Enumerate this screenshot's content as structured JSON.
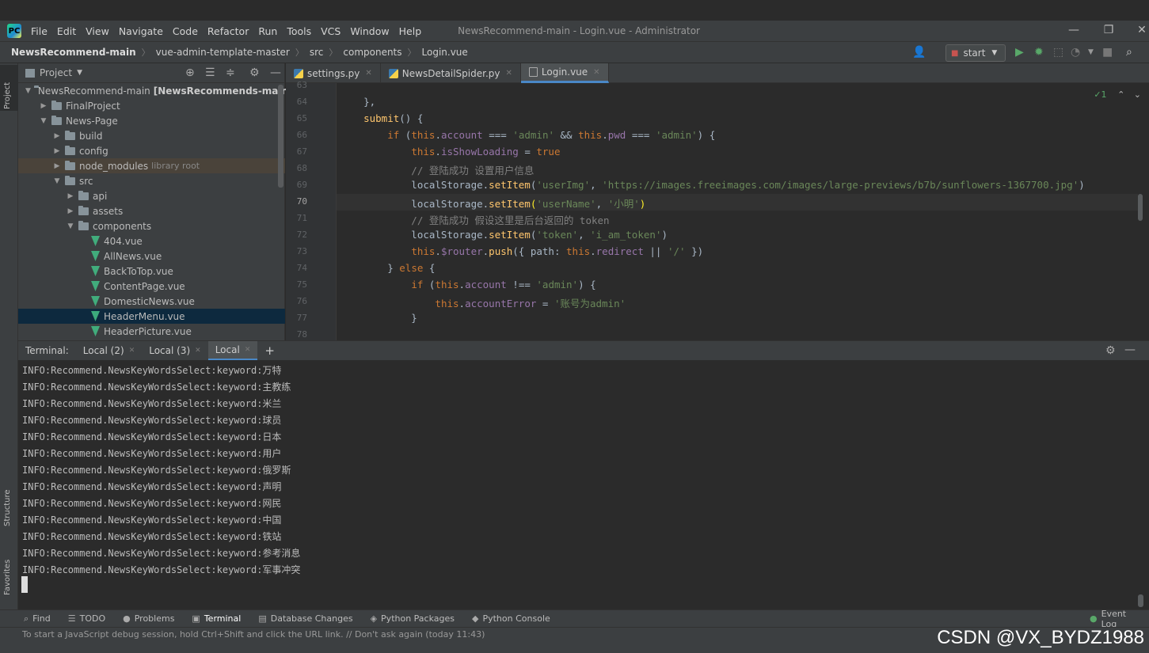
{
  "menubar": {
    "items": [
      "File",
      "Edit",
      "View",
      "Navigate",
      "Code",
      "Refactor",
      "Run",
      "Tools",
      "VCS",
      "Window",
      "Help"
    ],
    "window_title": "NewsRecommend-main - Login.vue - Administrator"
  },
  "navbar": {
    "crumbs": [
      "NewsRecommend-main",
      "vue-admin-template-master",
      "src",
      "components",
      "Login.vue"
    ],
    "run_config": "start"
  },
  "left_strip": {
    "project": "Project",
    "structure": "Structure",
    "favorites": "Favorites"
  },
  "project_panel": {
    "title": "Project",
    "tree": [
      {
        "label": "NewsRecommend-main",
        "extra": "[NewsRecommends-main]",
        "type": "folder",
        "open": true,
        "depth": 0
      },
      {
        "label": "FinalProject",
        "type": "folder",
        "open": false,
        "depth": 1
      },
      {
        "label": "News-Page",
        "type": "folder",
        "open": true,
        "depth": 1
      },
      {
        "label": "build",
        "type": "folder",
        "open": false,
        "depth": 2
      },
      {
        "label": "config",
        "type": "folder",
        "open": false,
        "depth": 2
      },
      {
        "label": "node_modules",
        "extra": "library root",
        "type": "folder",
        "open": false,
        "depth": 2,
        "lib": true
      },
      {
        "label": "src",
        "type": "folder",
        "open": true,
        "depth": 2
      },
      {
        "label": "api",
        "type": "folder",
        "open": false,
        "depth": 3
      },
      {
        "label": "assets",
        "type": "folder",
        "open": false,
        "depth": 3
      },
      {
        "label": "components",
        "type": "folder",
        "open": true,
        "depth": 3
      },
      {
        "label": "404.vue",
        "type": "vue",
        "depth": 4
      },
      {
        "label": "AllNews.vue",
        "type": "vue",
        "depth": 4
      },
      {
        "label": "BackToTop.vue",
        "type": "vue",
        "depth": 4
      },
      {
        "label": "ContentPage.vue",
        "type": "vue",
        "depth": 4
      },
      {
        "label": "DomesticNews.vue",
        "type": "vue",
        "depth": 4
      },
      {
        "label": "HeaderMenu.vue",
        "type": "vue",
        "depth": 4,
        "selected": true
      },
      {
        "label": "HeaderPicture.vue",
        "type": "vue",
        "depth": 4
      }
    ]
  },
  "editor": {
    "tabs": [
      {
        "label": "settings.py",
        "kind": "py",
        "active": false
      },
      {
        "label": "NewsDetailSpider.py",
        "kind": "py",
        "active": false
      },
      {
        "label": "Login.vue",
        "kind": "vue",
        "active": true
      }
    ],
    "inspection": "✓1",
    "current_line": "70",
    "lines": [
      {
        "n": "63",
        "tokens": [
          [
            "",
            ""
          ]
        ]
      },
      {
        "n": "64",
        "tokens": [
          [
            "    },",
            "p"
          ]
        ]
      },
      {
        "n": "65",
        "tokens": [
          [
            "    ",
            "p"
          ],
          [
            "submit",
            "fn"
          ],
          [
            "() {",
            "p"
          ]
        ]
      },
      {
        "n": "66",
        "tokens": [
          [
            "        ",
            "p"
          ],
          [
            "if",
            "kw"
          ],
          [
            " (",
            "p"
          ],
          [
            "this",
            "kw"
          ],
          [
            ".",
            "p"
          ],
          [
            "account",
            "fld"
          ],
          [
            " === ",
            "p"
          ],
          [
            "'admin'",
            "str"
          ],
          [
            " && ",
            "p"
          ],
          [
            "this",
            "kw"
          ],
          [
            ".",
            "p"
          ],
          [
            "pwd",
            "fld"
          ],
          [
            " === ",
            "p"
          ],
          [
            "'admin'",
            "str"
          ],
          [
            ") {",
            "p"
          ]
        ]
      },
      {
        "n": "67",
        "tokens": [
          [
            "            ",
            "p"
          ],
          [
            "this",
            "kw"
          ],
          [
            ".",
            "p"
          ],
          [
            "isShowLoading",
            "fld"
          ],
          [
            " = ",
            "p"
          ],
          [
            "true",
            "kw"
          ]
        ]
      },
      {
        "n": "68",
        "tokens": [
          [
            "            // 登陆成功 设置用户信息",
            "cmt"
          ]
        ]
      },
      {
        "n": "69",
        "tokens": [
          [
            "            localStorage.",
            "p"
          ],
          [
            "setItem",
            "fn"
          ],
          [
            "(",
            "p"
          ],
          [
            "'userImg'",
            "str"
          ],
          [
            ", ",
            "p"
          ],
          [
            "'https://images.freeimages.com/images/large-previews/b7b/sunflowers-1367700.jpg'",
            "str"
          ],
          [
            ")",
            "p"
          ]
        ]
      },
      {
        "n": "70",
        "tokens": [
          [
            "            localStorage.",
            "p"
          ],
          [
            "setItem",
            "fn"
          ],
          [
            "(",
            "hl"
          ],
          [
            "'userName'",
            "str"
          ],
          [
            ", ",
            "p"
          ],
          [
            "'小明'",
            "str"
          ],
          [
            ")",
            "hl"
          ]
        ]
      },
      {
        "n": "71",
        "tokens": [
          [
            "            // 登陆成功 假设这里是后台返回的 token",
            "cmt"
          ]
        ]
      },
      {
        "n": "72",
        "tokens": [
          [
            "            localStorage.",
            "p"
          ],
          [
            "setItem",
            "fn"
          ],
          [
            "(",
            "p"
          ],
          [
            "'token'",
            "str"
          ],
          [
            ", ",
            "p"
          ],
          [
            "'i_am_token'",
            "str"
          ],
          [
            ")",
            "p"
          ]
        ]
      },
      {
        "n": "73",
        "tokens": [
          [
            "            ",
            "p"
          ],
          [
            "this",
            "kw"
          ],
          [
            ".",
            "p"
          ],
          [
            "$router",
            "fld"
          ],
          [
            ".",
            "p"
          ],
          [
            "push",
            "fn"
          ],
          [
            "({ path: ",
            "p"
          ],
          [
            "this",
            "kw"
          ],
          [
            ".",
            "p"
          ],
          [
            "redirect",
            "fld"
          ],
          [
            " || ",
            "p"
          ],
          [
            "'/'",
            "str"
          ],
          [
            " })",
            "p"
          ]
        ]
      },
      {
        "n": "74",
        "tokens": [
          [
            "        } ",
            "p"
          ],
          [
            "else",
            "kw"
          ],
          [
            " {",
            "p"
          ]
        ]
      },
      {
        "n": "75",
        "tokens": [
          [
            "            ",
            "p"
          ],
          [
            "if",
            "kw"
          ],
          [
            " (",
            "p"
          ],
          [
            "this",
            "kw"
          ],
          [
            ".",
            "p"
          ],
          [
            "account",
            "fld"
          ],
          [
            " !== ",
            "p"
          ],
          [
            "'admin'",
            "str"
          ],
          [
            ") {",
            "p"
          ]
        ]
      },
      {
        "n": "76",
        "tokens": [
          [
            "                ",
            "p"
          ],
          [
            "this",
            "kw"
          ],
          [
            ".",
            "p"
          ],
          [
            "accountError",
            "fld"
          ],
          [
            " = ",
            "p"
          ],
          [
            "'账号为admin'",
            "str"
          ]
        ]
      },
      {
        "n": "77",
        "tokens": [
          [
            "            }",
            "p"
          ]
        ]
      },
      {
        "n": "78",
        "tokens": [
          [
            "",
            ""
          ]
        ]
      }
    ]
  },
  "terminal": {
    "label": "Terminal:",
    "tabs": [
      {
        "label": "Local (2)",
        "active": false
      },
      {
        "label": "Local (3)",
        "active": false
      },
      {
        "label": "Local",
        "active": true
      }
    ],
    "add": "+",
    "lines": [
      "INFO:Recommend.NewsKeyWordsSelect:keyword:万特",
      "INFO:Recommend.NewsKeyWordsSelect:keyword:主教练",
      "INFO:Recommend.NewsKeyWordsSelect:keyword:米兰",
      "INFO:Recommend.NewsKeyWordsSelect:keyword:球员",
      "INFO:Recommend.NewsKeyWordsSelect:keyword:日本",
      "INFO:Recommend.NewsKeyWordsSelect:keyword:用户",
      "INFO:Recommend.NewsKeyWordsSelect:keyword:俄罗斯",
      "INFO:Recommend.NewsKeyWordsSelect:keyword:声明",
      "INFO:Recommend.NewsKeyWordsSelect:keyword:网民",
      "INFO:Recommend.NewsKeyWordsSelect:keyword:中国",
      "INFO:Recommend.NewsKeyWordsSelect:keyword:铁站",
      "INFO:Recommend.NewsKeyWordsSelect:keyword:参考消息",
      "INFO:Recommend.NewsKeyWordsSelect:keyword:军事冲突"
    ]
  },
  "bottom_bar": {
    "items": [
      {
        "label": "Find",
        "icon": "search-icon",
        "active": false
      },
      {
        "label": "TODO",
        "icon": "list-icon",
        "active": false
      },
      {
        "label": "Problems",
        "icon": "alert-icon",
        "active": false
      },
      {
        "label": "Terminal",
        "icon": "terminal-icon",
        "active": true
      },
      {
        "label": "Database Changes",
        "icon": "database-icon",
        "active": false
      },
      {
        "label": "Python Packages",
        "icon": "package-icon",
        "active": false
      },
      {
        "label": "Python Console",
        "icon": "python-icon",
        "active": false
      }
    ],
    "event_log": "Event Log"
  },
  "status": {
    "message": "To start a JavaScript debug session, hold Ctrl+Shift and click the URL link. // Don't ask again (today 11:43)"
  },
  "watermark": "CSDN @VX_BYDZ1988",
  "colors": {
    "bg": "#2b2b2b",
    "panel": "#3c3f41",
    "accent": "#4a88c7",
    "selection": "#0d293e"
  }
}
